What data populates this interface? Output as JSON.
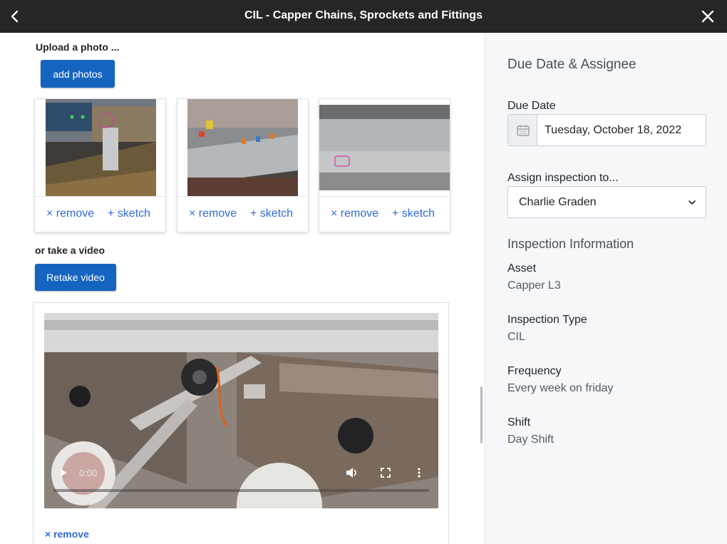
{
  "header": {
    "title": "CIL - Capper Chains, Sprockets and Fittings",
    "back_icon": "chevron-left-icon",
    "close_icon": "close-icon"
  },
  "photos": {
    "section_label": "Upload a photo ...",
    "add_button_label": "add photos",
    "items": [
      {
        "remove_label": "× remove",
        "sketch_label": "+ sketch"
      },
      {
        "remove_label": "× remove",
        "sketch_label": "+ sketch"
      },
      {
        "remove_label": "× remove",
        "sketch_label": "+ sketch"
      }
    ]
  },
  "video": {
    "section_label": "or take a video",
    "retake_button_label": "Retake video",
    "current_time": "0:00",
    "remove_label": "× remove"
  },
  "sidebar": {
    "heading": "Due Date & Assignee",
    "due_date_label": "Due Date",
    "due_date_value": "Tuesday, October 18, 2022",
    "assign_label": "Assign inspection to...",
    "assignee_value": "Charlie Graden",
    "info_heading": "Inspection Information",
    "fields": [
      {
        "label": "Asset",
        "value": "Capper L3"
      },
      {
        "label": "Inspection Type",
        "value": "CIL"
      },
      {
        "label": "Frequency",
        "value": "Every week on friday"
      },
      {
        "label": "Shift",
        "value": "Day Shift"
      }
    ]
  },
  "colors": {
    "topbar": "#262626",
    "primary_button": "#1565c0",
    "link": "#2f6bd6",
    "sidebar_bg": "#f6f7f9"
  }
}
